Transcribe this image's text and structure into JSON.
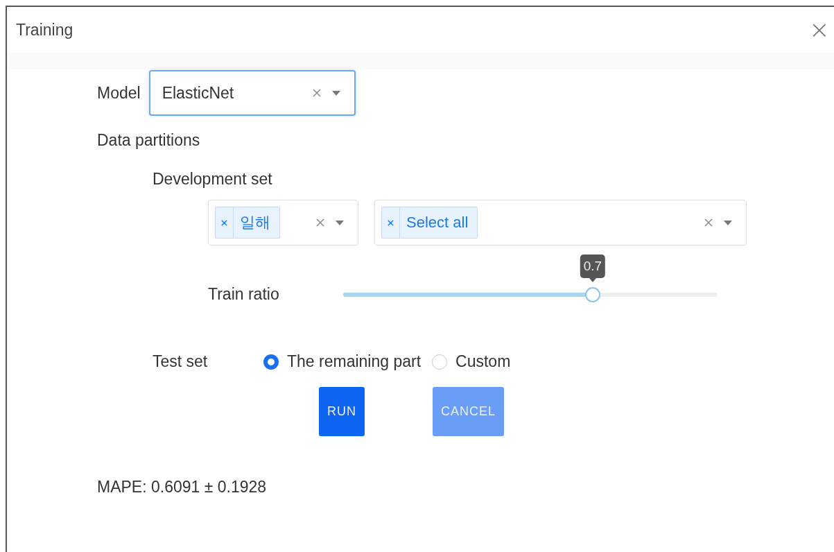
{
  "dialog": {
    "title": "Training",
    "close": "×"
  },
  "model": {
    "label": "Model",
    "value": "ElasticNet",
    "focused": true
  },
  "data_partitions": {
    "label": "Data partitions",
    "development_set": {
      "label": "Development set",
      "selects": [
        {
          "tags": [
            "일해"
          ]
        },
        {
          "tags": [
            "Select all"
          ]
        }
      ]
    },
    "train_ratio": {
      "label": "Train ratio",
      "level": 0.667,
      "tooltip": "0.7"
    },
    "test_set": {
      "label": "Test set",
      "options": [
        {
          "label": "The remaining part",
          "selected": true
        },
        {
          "label": "Custom",
          "selected": false
        }
      ]
    }
  },
  "buttons": [
    {
      "label": "RUN",
      "disabled": false
    },
    {
      "label": "CANCEL",
      "disabled": true
    }
  ],
  "result": "MAPE: 0.6091 ± 0.1928"
}
